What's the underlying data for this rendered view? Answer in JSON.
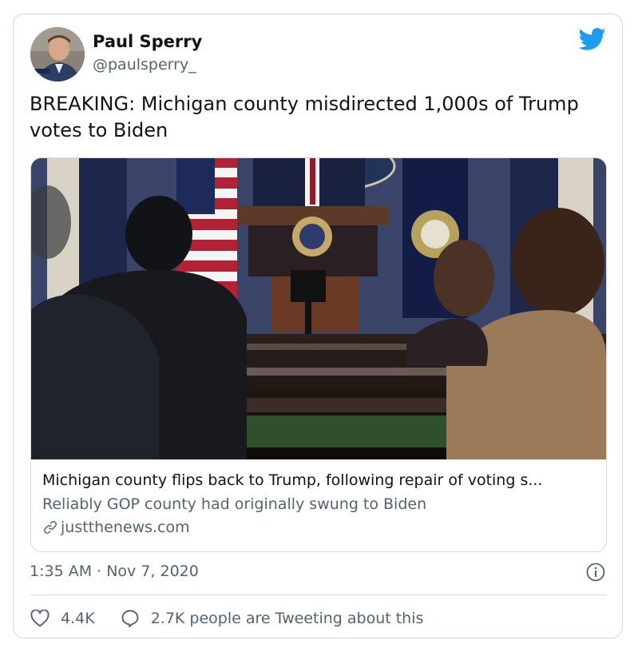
{
  "author": {
    "name": "Paul Sperry",
    "handle": "@paulsperry_"
  },
  "tweet": {
    "text": "BREAKING: Michigan county misdirected 1,000s of Trump votes to Biden",
    "timestamp": "1:35 AM · Nov 7, 2020"
  },
  "link_card": {
    "title": "Michigan county flips back to Trump, following repair of voting s...",
    "description": "Reliably GOP county had originally swung to Biden",
    "domain": "justthenews.com"
  },
  "actions": {
    "likes": "4.4K",
    "conversation": "2.7K people are Tweeting about this"
  },
  "colors": {
    "brand": "#1d9bf0",
    "text_primary": "#0f1419",
    "text_secondary": "#536471",
    "border": "#cfd9de"
  },
  "icons": {
    "brand": "twitter-bird-icon",
    "link": "link-icon",
    "info": "info-icon",
    "like": "heart-icon",
    "reply": "speech-bubble-icon"
  }
}
